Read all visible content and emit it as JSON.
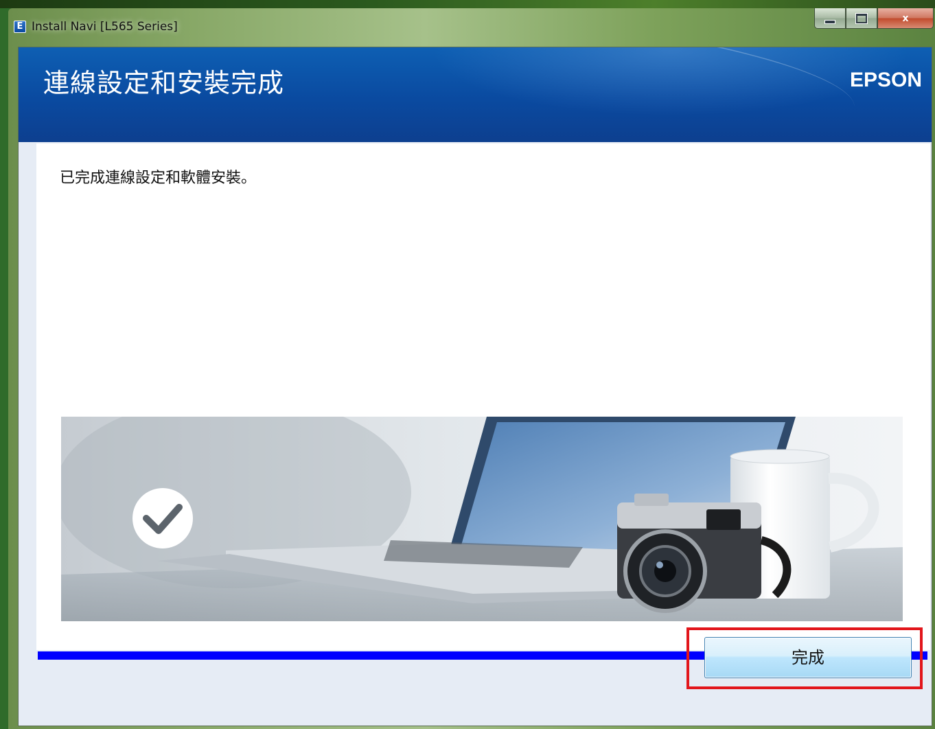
{
  "window": {
    "title": "Install Navi [L565 Series]",
    "icon_letter": "E",
    "controls": {
      "minimize_icon": "minimize-icon",
      "maximize_icon": "maximize-icon",
      "close_label": "x"
    }
  },
  "header": {
    "title": "連線設定和安裝完成",
    "brand": "EPSON"
  },
  "content": {
    "message": "已完成連線設定和軟體安裝。",
    "illustration_icons": [
      "checkmark-circle-icon",
      "laptop-icon",
      "camera-icon",
      "mug-icon"
    ]
  },
  "progress": {
    "value": 1.0,
    "color": "#0000ff"
  },
  "footer": {
    "finish_label": "完成"
  },
  "colors": {
    "header": "#0a4aa0",
    "highlight_box": "#e2161b",
    "progress": "#0000ff"
  }
}
